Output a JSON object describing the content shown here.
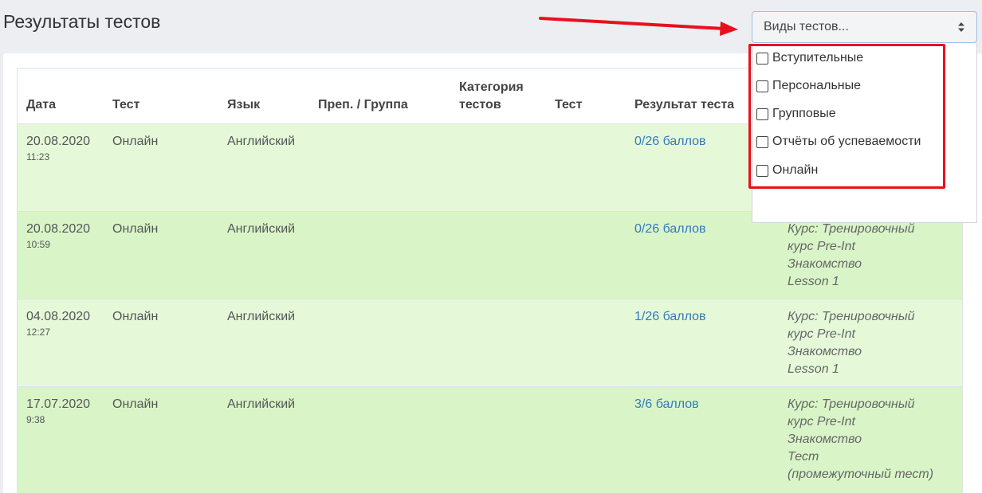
{
  "page": {
    "title": "Результаты тестов"
  },
  "filter": {
    "select_label": "Виды тестов...",
    "options": [
      "Вступительные",
      "Персональные",
      "Групповые",
      "Отчёты об успеваемости",
      "Онлайн"
    ]
  },
  "table": {
    "headers": [
      "Дата",
      "Тест",
      "Язык",
      "Преп. / Группа",
      "Категория тестов",
      "Тест",
      "Результат теста"
    ],
    "rows": [
      {
        "date": "20.08.2020",
        "time": "11:23",
        "test": "Онлайн",
        "lang": "Английский",
        "teacher": "",
        "category": "",
        "test2": "",
        "result": "0/26 баллов",
        "comment": []
      },
      {
        "date": "20.08.2020",
        "time": "10:59",
        "test": "Онлайн",
        "lang": "Английский",
        "teacher": "",
        "category": "",
        "test2": "",
        "result": "0/26 баллов",
        "comment": [
          "Курс: Тренировочный",
          "курс Pre-Int",
          "Знакомство",
          "Lesson 1"
        ]
      },
      {
        "date": "04.08.2020",
        "time": "12:27",
        "test": "Онлайн",
        "lang": "Английский",
        "teacher": "",
        "category": "",
        "test2": "",
        "result": "1/26 баллов",
        "comment": [
          "Курс: Тренировочный",
          "курс Pre-Int",
          "Знакомство",
          "Lesson 1"
        ]
      },
      {
        "date": "17.07.2020",
        "time": "9:38",
        "test": "Онлайн",
        "lang": "Английский",
        "teacher": "",
        "category": "",
        "test2": "",
        "result": "3/6 баллов",
        "comment": [
          "Курс: Тренировочный",
          "курс Pre-Int",
          "Знакомство",
          "Тест",
          "(промежуточный тест)"
        ]
      }
    ]
  },
  "colors": {
    "annotation_red": "#e8101c",
    "row_light": "#e5f9d9",
    "row_dark": "#d9f5c8",
    "link": "#337ab7"
  }
}
